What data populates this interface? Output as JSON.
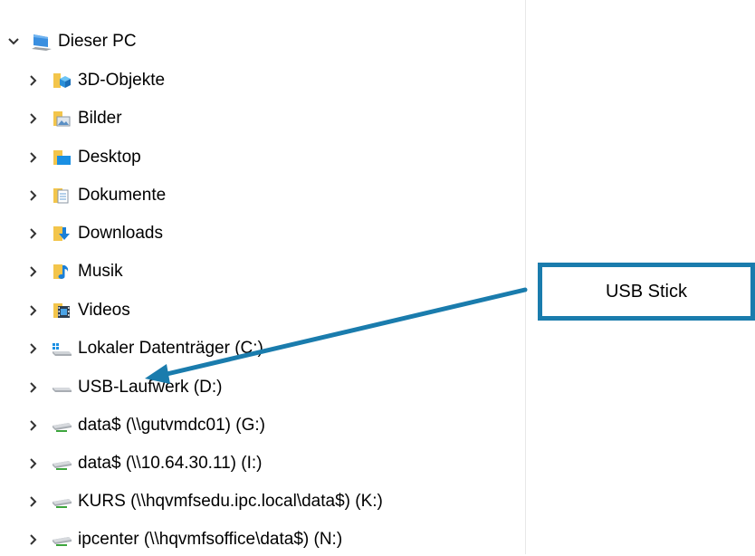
{
  "tree": {
    "root": {
      "label": "Dieser PC",
      "icon": "pc-icon",
      "expanded": true
    },
    "items": [
      {
        "label": "3D-Objekte",
        "icon": "3d-objects-folder-icon"
      },
      {
        "label": "Bilder",
        "icon": "pictures-folder-icon"
      },
      {
        "label": "Desktop",
        "icon": "desktop-folder-icon"
      },
      {
        "label": "Dokumente",
        "icon": "documents-folder-icon"
      },
      {
        "label": "Downloads",
        "icon": "downloads-folder-icon"
      },
      {
        "label": "Musik",
        "icon": "music-folder-icon"
      },
      {
        "label": "Videos",
        "icon": "videos-folder-icon"
      },
      {
        "label": "Lokaler Datenträger (C:)",
        "icon": "local-disk-icon"
      },
      {
        "label": "USB-Laufwerk (D:)",
        "icon": "usb-drive-icon"
      },
      {
        "label": "data$ (\\\\gutvmdc01) (G:)",
        "icon": "network-drive-icon"
      },
      {
        "label": "data$ (\\\\10.64.30.11) (I:)",
        "icon": "network-drive-icon"
      },
      {
        "label": "KURS (\\\\hqvmfsedu.ipc.local\\data$) (K:)",
        "icon": "network-drive-icon"
      },
      {
        "label": "ipcenter (\\\\hqvmfsoffice\\data$) (N:)",
        "icon": "network-drive-icon"
      }
    ]
  },
  "annotation": {
    "label": "USB Stick",
    "color": "#1a7cad"
  }
}
